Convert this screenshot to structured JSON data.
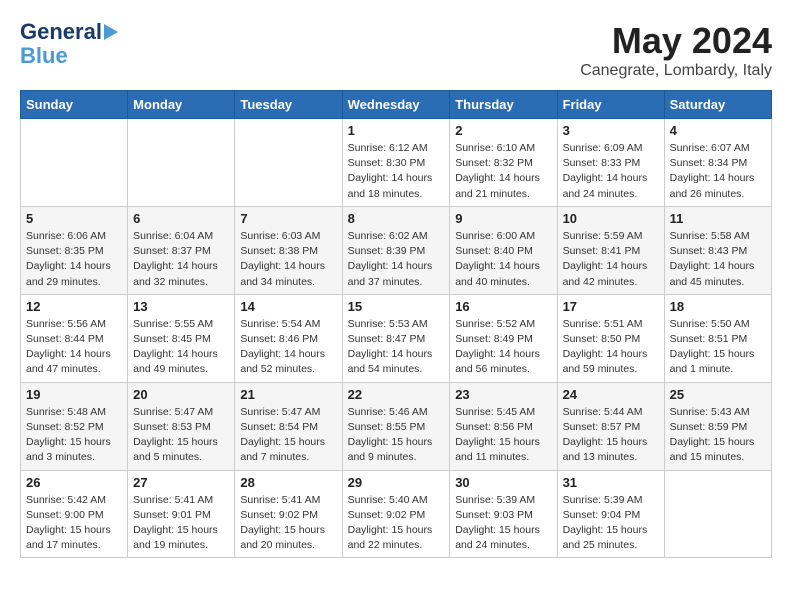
{
  "header": {
    "logo_line1": "General",
    "logo_line2": "Blue",
    "month": "May 2024",
    "location": "Canegrate, Lombardy, Italy"
  },
  "days_of_week": [
    "Sunday",
    "Monday",
    "Tuesday",
    "Wednesday",
    "Thursday",
    "Friday",
    "Saturday"
  ],
  "weeks": [
    [
      {
        "day": "",
        "info": ""
      },
      {
        "day": "",
        "info": ""
      },
      {
        "day": "",
        "info": ""
      },
      {
        "day": "1",
        "info": "Sunrise: 6:12 AM\nSunset: 8:30 PM\nDaylight: 14 hours and 18 minutes."
      },
      {
        "day": "2",
        "info": "Sunrise: 6:10 AM\nSunset: 8:32 PM\nDaylight: 14 hours and 21 minutes."
      },
      {
        "day": "3",
        "info": "Sunrise: 6:09 AM\nSunset: 8:33 PM\nDaylight: 14 hours and 24 minutes."
      },
      {
        "day": "4",
        "info": "Sunrise: 6:07 AM\nSunset: 8:34 PM\nDaylight: 14 hours and 26 minutes."
      }
    ],
    [
      {
        "day": "5",
        "info": "Sunrise: 6:06 AM\nSunset: 8:35 PM\nDaylight: 14 hours and 29 minutes."
      },
      {
        "day": "6",
        "info": "Sunrise: 6:04 AM\nSunset: 8:37 PM\nDaylight: 14 hours and 32 minutes."
      },
      {
        "day": "7",
        "info": "Sunrise: 6:03 AM\nSunset: 8:38 PM\nDaylight: 14 hours and 34 minutes."
      },
      {
        "day": "8",
        "info": "Sunrise: 6:02 AM\nSunset: 8:39 PM\nDaylight: 14 hours and 37 minutes."
      },
      {
        "day": "9",
        "info": "Sunrise: 6:00 AM\nSunset: 8:40 PM\nDaylight: 14 hours and 40 minutes."
      },
      {
        "day": "10",
        "info": "Sunrise: 5:59 AM\nSunset: 8:41 PM\nDaylight: 14 hours and 42 minutes."
      },
      {
        "day": "11",
        "info": "Sunrise: 5:58 AM\nSunset: 8:43 PM\nDaylight: 14 hours and 45 minutes."
      }
    ],
    [
      {
        "day": "12",
        "info": "Sunrise: 5:56 AM\nSunset: 8:44 PM\nDaylight: 14 hours and 47 minutes."
      },
      {
        "day": "13",
        "info": "Sunrise: 5:55 AM\nSunset: 8:45 PM\nDaylight: 14 hours and 49 minutes."
      },
      {
        "day": "14",
        "info": "Sunrise: 5:54 AM\nSunset: 8:46 PM\nDaylight: 14 hours and 52 minutes."
      },
      {
        "day": "15",
        "info": "Sunrise: 5:53 AM\nSunset: 8:47 PM\nDaylight: 14 hours and 54 minutes."
      },
      {
        "day": "16",
        "info": "Sunrise: 5:52 AM\nSunset: 8:49 PM\nDaylight: 14 hours and 56 minutes."
      },
      {
        "day": "17",
        "info": "Sunrise: 5:51 AM\nSunset: 8:50 PM\nDaylight: 14 hours and 59 minutes."
      },
      {
        "day": "18",
        "info": "Sunrise: 5:50 AM\nSunset: 8:51 PM\nDaylight: 15 hours and 1 minute."
      }
    ],
    [
      {
        "day": "19",
        "info": "Sunrise: 5:48 AM\nSunset: 8:52 PM\nDaylight: 15 hours and 3 minutes."
      },
      {
        "day": "20",
        "info": "Sunrise: 5:47 AM\nSunset: 8:53 PM\nDaylight: 15 hours and 5 minutes."
      },
      {
        "day": "21",
        "info": "Sunrise: 5:47 AM\nSunset: 8:54 PM\nDaylight: 15 hours and 7 minutes."
      },
      {
        "day": "22",
        "info": "Sunrise: 5:46 AM\nSunset: 8:55 PM\nDaylight: 15 hours and 9 minutes."
      },
      {
        "day": "23",
        "info": "Sunrise: 5:45 AM\nSunset: 8:56 PM\nDaylight: 15 hours and 11 minutes."
      },
      {
        "day": "24",
        "info": "Sunrise: 5:44 AM\nSunset: 8:57 PM\nDaylight: 15 hours and 13 minutes."
      },
      {
        "day": "25",
        "info": "Sunrise: 5:43 AM\nSunset: 8:59 PM\nDaylight: 15 hours and 15 minutes."
      }
    ],
    [
      {
        "day": "26",
        "info": "Sunrise: 5:42 AM\nSunset: 9:00 PM\nDaylight: 15 hours and 17 minutes."
      },
      {
        "day": "27",
        "info": "Sunrise: 5:41 AM\nSunset: 9:01 PM\nDaylight: 15 hours and 19 minutes."
      },
      {
        "day": "28",
        "info": "Sunrise: 5:41 AM\nSunset: 9:02 PM\nDaylight: 15 hours and 20 minutes."
      },
      {
        "day": "29",
        "info": "Sunrise: 5:40 AM\nSunset: 9:02 PM\nDaylight: 15 hours and 22 minutes."
      },
      {
        "day": "30",
        "info": "Sunrise: 5:39 AM\nSunset: 9:03 PM\nDaylight: 15 hours and 24 minutes."
      },
      {
        "day": "31",
        "info": "Sunrise: 5:39 AM\nSunset: 9:04 PM\nDaylight: 15 hours and 25 minutes."
      },
      {
        "day": "",
        "info": ""
      }
    ]
  ]
}
